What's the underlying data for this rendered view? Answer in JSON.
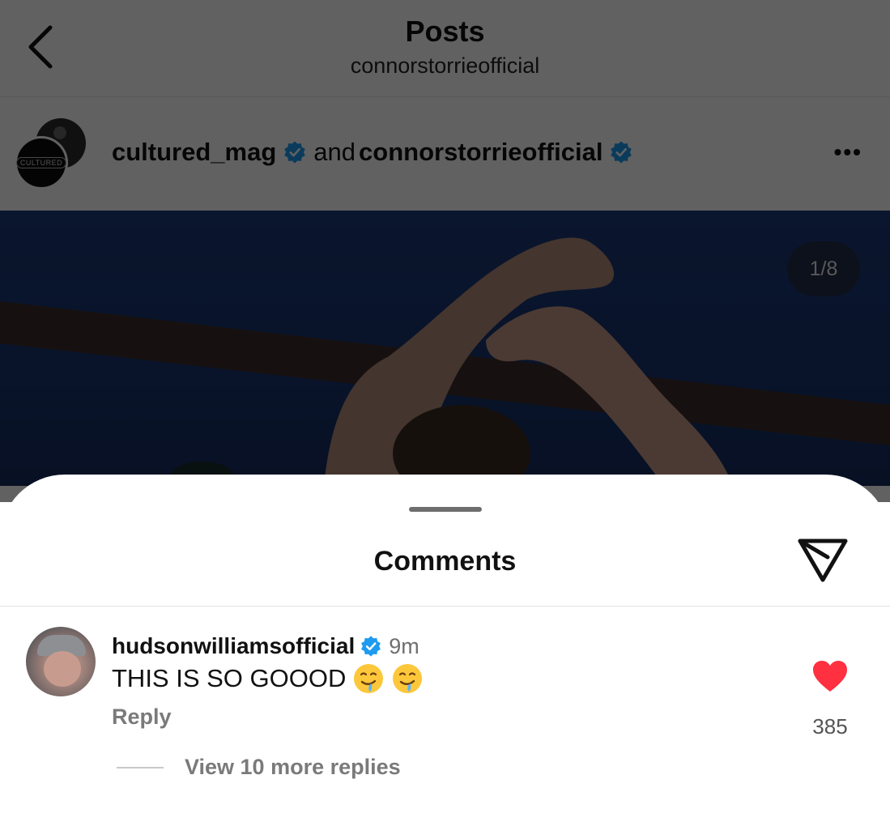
{
  "topbar": {
    "title": "Posts",
    "subtitle": "connorstorrieofficial",
    "back_icon": "chevron-left-icon"
  },
  "post": {
    "author_primary": "cultured_mag",
    "joiner": "and",
    "author_secondary": "connorstorrieofficial",
    "avatar_text": "CULTURED",
    "verified_icon": "verified-badge-icon",
    "more_icon": "more-horizontal-icon",
    "more_label": "•••",
    "image_counter": "1/8"
  },
  "comments_sheet": {
    "title": "Comments",
    "share_icon": "send-icon",
    "comments": [
      {
        "username": "hudsonwilliamsofficial",
        "verified": true,
        "time": "9m",
        "text": "THIS IS SO GOOOD",
        "emojis": [
          "drooling-face-emoji",
          "drooling-face-emoji"
        ],
        "reply_label": "Reply",
        "liked": true,
        "like_count": "385",
        "view_replies_label": "View 10 more replies"
      }
    ]
  },
  "colors": {
    "verified_blue": "#1d9bf0",
    "like_red": "#ff3040",
    "photo_sky": "#1c3a78",
    "secondary_text": "#7a7a7a"
  }
}
